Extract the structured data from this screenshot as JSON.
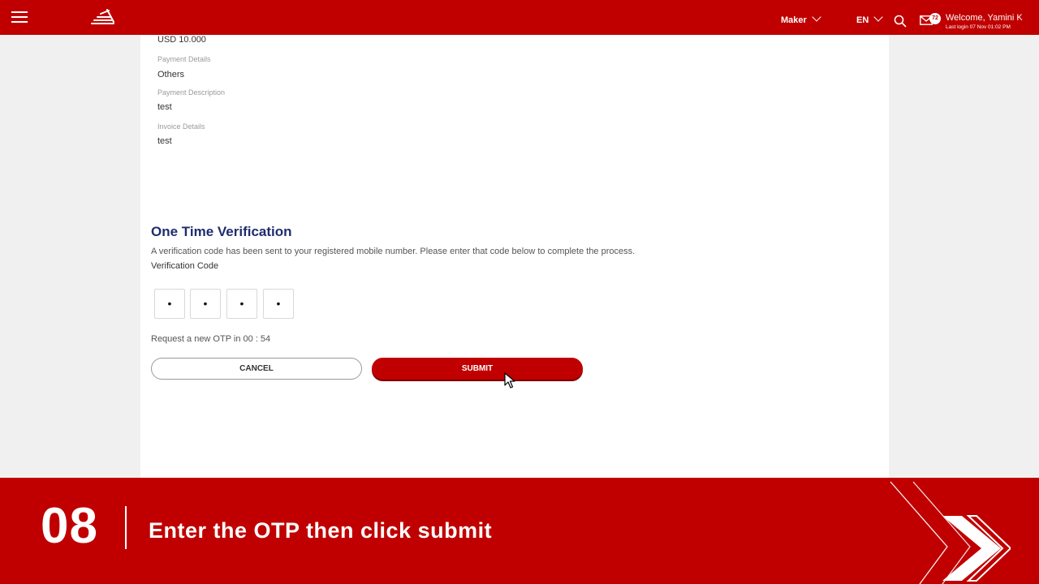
{
  "header": {
    "role": "Maker",
    "language": "EN",
    "welcome": "Welcome, Yamini K",
    "last_login": "Last login 07 Nov 01:02 PM",
    "mail_count": "72",
    "brand_color": "#c00000"
  },
  "details": {
    "amount": "USD 10.000",
    "payment_details_label": "Payment Details",
    "payment_details_value": "Others",
    "payment_description_label": "Payment Description",
    "payment_description_value": "test",
    "invoice_details_label": "Invoice Details",
    "invoice_details_value": "test"
  },
  "otp": {
    "title": "One Time Verification",
    "message": "A verification code has been sent to your registered mobile number. Please enter that code below to complete the process.",
    "code_label": "Verification Code",
    "digits": [
      "•",
      "•",
      "•",
      "•"
    ],
    "resend_text": "Request a new OTP in 00 : 54",
    "cancel_label": "CANCEL",
    "submit_label": "SUBMIT"
  },
  "banner": {
    "step_number": "08",
    "step_text": "Enter the OTP then click submit"
  }
}
